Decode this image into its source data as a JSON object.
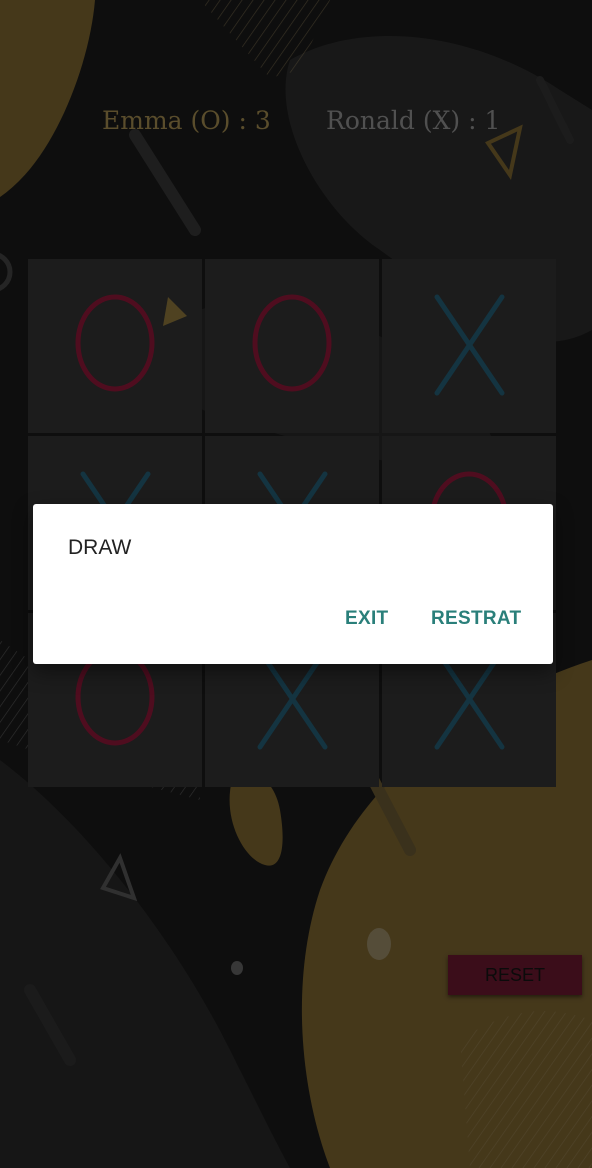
{
  "colors": {
    "background": "#161616",
    "gold": "#8a7333",
    "gold_bright": "#6e5a2c",
    "player_o_color": "#7a1530",
    "player_x_color": "#1f5164",
    "score_o_color": "#8a7744",
    "score_x_color": "#7c7c7c",
    "dialog_button_color": "#2a7f7a",
    "reset_button_color": "#5b1428"
  },
  "scores": {
    "player1": "Emma (O) : 3",
    "player2": "Ronald (X) : 1"
  },
  "board": {
    "cells": [
      "O",
      "O",
      "X",
      "X",
      "X",
      "O",
      "O",
      "X",
      "X"
    ]
  },
  "reset_button": {
    "label": "RESET"
  },
  "dialog": {
    "message": "DRAW",
    "exit_label": "EXIT",
    "restart_label": "RESTRAT"
  }
}
